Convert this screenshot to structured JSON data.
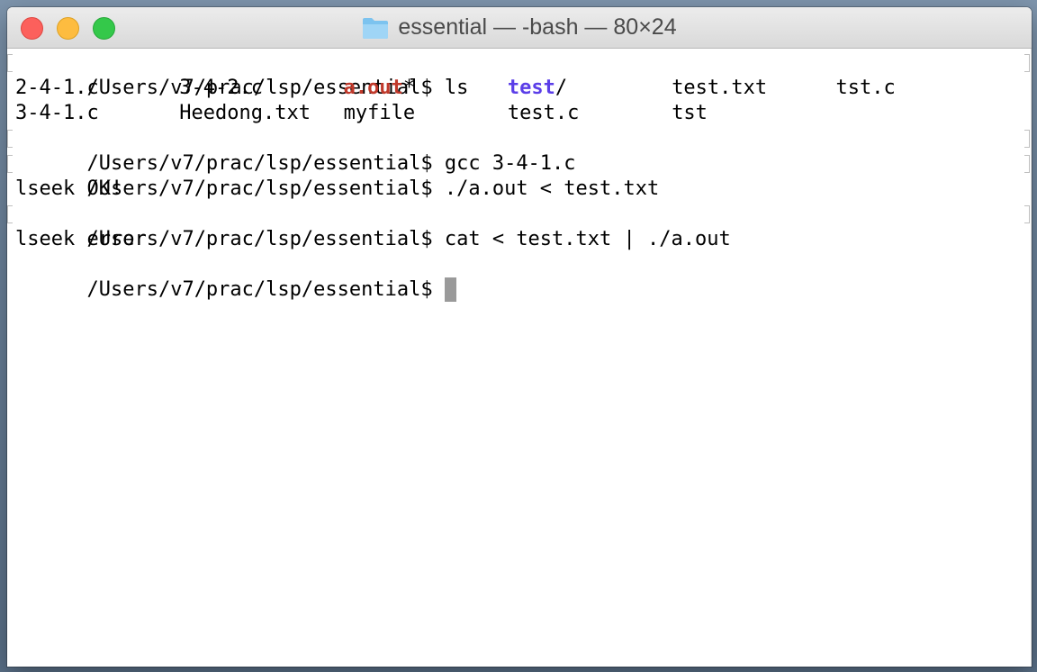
{
  "window": {
    "title": "essential — -bash — 80×24",
    "folder_icon": "folder-icon"
  },
  "colors": {
    "executable": "#c0392b",
    "directory": "#5b3ee8",
    "cursor": "#9a9a9a"
  },
  "terminal": {
    "prompt": "/Users/v7/prac/lsp/essential$ ",
    "cmd1": "ls",
    "ls_row1": [
      "2-4-1.c",
      "3-4-2.c",
      "a.out",
      "*",
      "test",
      "/",
      "test.txt",
      "tst.c"
    ],
    "ls_row2": [
      "3-4-1.c",
      "Heedong.txt",
      "myfile",
      "test.c",
      "tst"
    ],
    "cmd2": "gcc 3-4-1.c",
    "cmd3": "./a.out < test.txt",
    "out3": "lseek OK!",
    "cmd4": "cat < test.txt | ./a.out",
    "out4": "lseek error"
  }
}
